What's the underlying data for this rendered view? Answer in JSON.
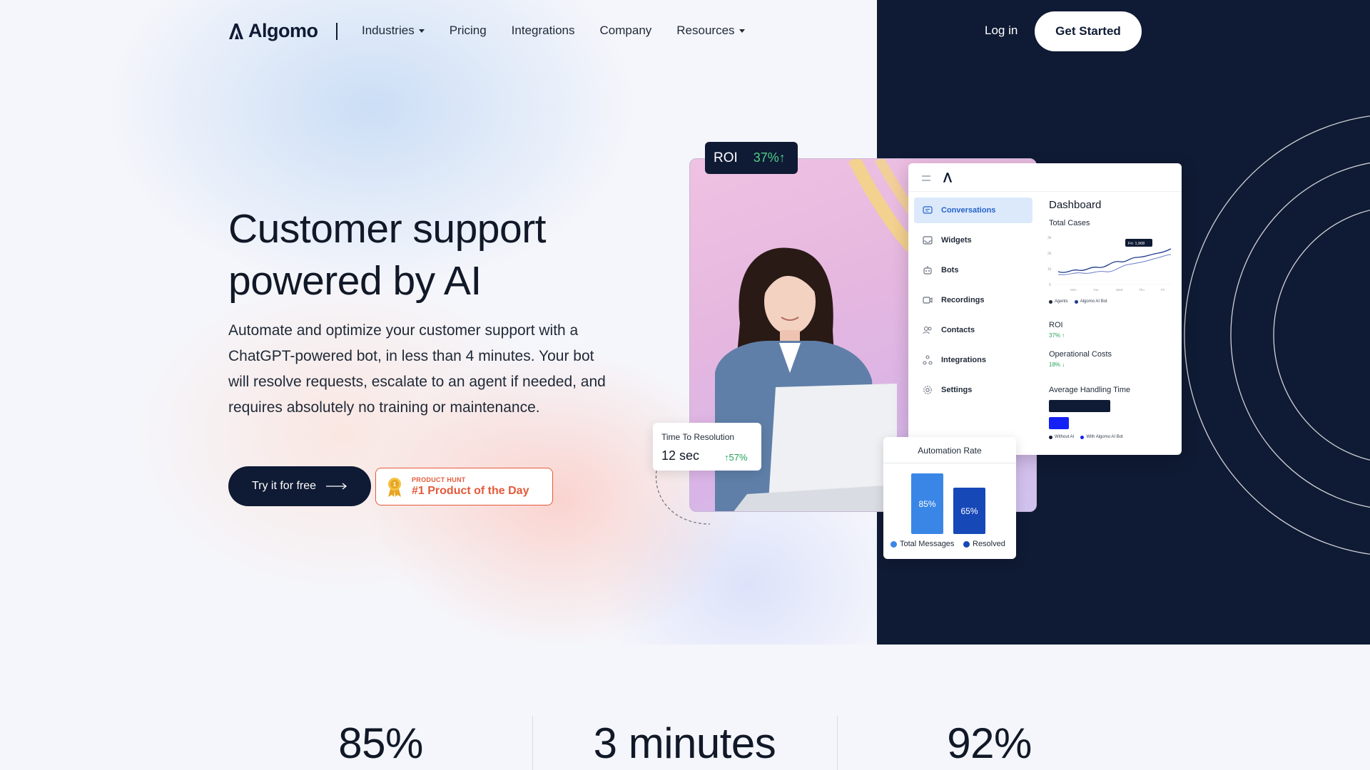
{
  "brand": {
    "name": "Algomo"
  },
  "nav": {
    "items": [
      {
        "label": "Industries",
        "has_caret": true
      },
      {
        "label": "Pricing",
        "has_caret": false
      },
      {
        "label": "Integrations",
        "has_caret": false
      },
      {
        "label": "Company",
        "has_caret": false
      },
      {
        "label": "Resources",
        "has_caret": true
      }
    ],
    "login": "Log in",
    "get_started": "Get Started"
  },
  "hero": {
    "title_line1": "Customer support",
    "title_line2": "powered by AI",
    "description": "Automate and optimize your customer support with a ChatGPT-powered bot, in less than 4 minutes. Your bot will resolve requests, escalate to an agent if needed, and requires absolutely no training or maintenance.",
    "cta": "Try it for free",
    "badge_small": "PRODUCT HUNT",
    "badge_main": "#1 Product of the Day"
  },
  "mockup": {
    "roi_chip": {
      "label": "ROI",
      "value": "37%↑"
    },
    "sidebar": [
      {
        "label": "Conversations",
        "icon": "chat-icon",
        "active": true
      },
      {
        "label": "Widgets",
        "icon": "inbox-icon",
        "active": false
      },
      {
        "label": "Bots",
        "icon": "bot-icon",
        "active": false
      },
      {
        "label": "Recordings",
        "icon": "video-icon",
        "active": false
      },
      {
        "label": "Contacts",
        "icon": "users-icon",
        "active": false
      },
      {
        "label": "Integrations",
        "icon": "integrations-icon",
        "active": false
      },
      {
        "label": "Settings",
        "icon": "gear-icon",
        "active": false
      }
    ],
    "dashboard": {
      "title": "Dashboard",
      "total_cases": "Total Cases",
      "tooltip": "Fri: 1,908",
      "y_ticks": [
        "3k",
        "2k",
        "1k",
        "0"
      ],
      "x_ticks": [
        "Mon",
        "Tue",
        "Wed",
        "Thu",
        "Fri"
      ],
      "legend_agents": "Agents",
      "legend_bot": "Algomo AI Bot",
      "roi_label": "ROI",
      "roi_value": "37% ↑",
      "op_costs_label": "Operational Costs",
      "op_costs_value": "18% ↓",
      "aht_label": "Average Handling Time",
      "aht_legend_without": "Without AI",
      "aht_legend_with": "With Algomo AI Bot"
    },
    "ttr": {
      "label": "Time To Resolution",
      "value": "12 sec",
      "change": "↑57%"
    },
    "automation_rate": {
      "title": "Automation Rate",
      "bars": [
        {
          "label": "85%",
          "value": 85,
          "color": "#3a86e6"
        },
        {
          "label": "65%",
          "value": 65,
          "color": "#1648b8"
        }
      ],
      "legend": [
        {
          "label": "Total Messages",
          "color": "#3a86e6"
        },
        {
          "label": "Resolved",
          "color": "#1648b8"
        }
      ]
    }
  },
  "stats": [
    {
      "value": "85%"
    },
    {
      "value": "3 minutes"
    },
    {
      "value": "92%"
    }
  ],
  "colors": {
    "navy": "#0f1a34",
    "accent_orange": "#e45a3a",
    "green": "#22a35a",
    "blue": "#2563c9"
  }
}
